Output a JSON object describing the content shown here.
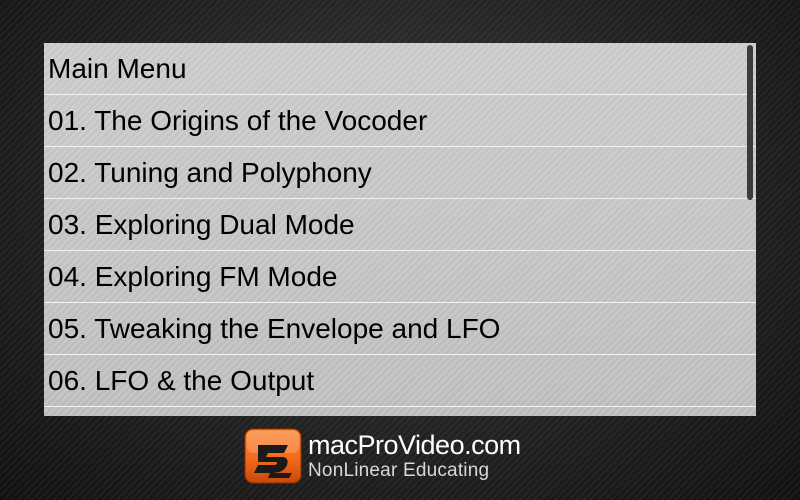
{
  "menu": {
    "items": [
      {
        "label": "Main Menu"
      },
      {
        "label": "01. The Origins of the Vocoder"
      },
      {
        "label": "02. Tuning and Polyphony"
      },
      {
        "label": "03. Exploring Dual Mode"
      },
      {
        "label": "04. Exploring FM Mode"
      },
      {
        "label": "05. Tweaking the Envelope and LFO"
      },
      {
        "label": "06. LFO & the Output"
      },
      {
        "label": ""
      }
    ]
  },
  "brand": {
    "name": "macProVideo.com",
    "tagline": "NonLinear Educating",
    "logo_icon": "macprovideo-logo-icon",
    "accent_color": "#f26a1b"
  }
}
